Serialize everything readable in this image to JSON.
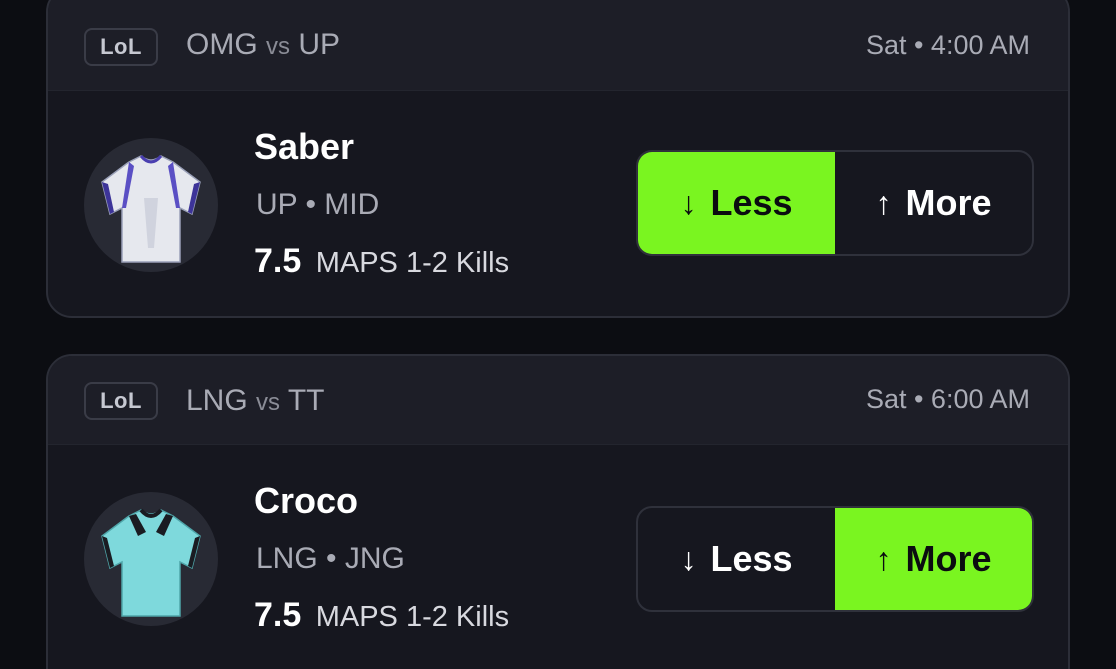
{
  "cards": [
    {
      "league": "LoL",
      "team1": "OMG",
      "vs": "vs",
      "team2": "UP",
      "time": "Sat • 4:00 AM",
      "player": "Saber",
      "team_position": "UP • MID",
      "line": "7.5",
      "stat": "MAPS 1-2 Kills",
      "jersey_colors": {
        "body": "#e6e8ee",
        "accent": "#5a4fc4"
      },
      "less_label": "Less",
      "more_label": "More",
      "selected": "less"
    },
    {
      "league": "LoL",
      "team1": "LNG",
      "vs": "vs",
      "team2": "TT",
      "time": "Sat • 6:00 AM",
      "player": "Croco",
      "team_position": "LNG • JNG",
      "line": "7.5",
      "stat": "MAPS 1-2 Kills",
      "jersey_colors": {
        "body": "#7ed9dc",
        "accent": "#1a1c22"
      },
      "less_label": "Less",
      "more_label": "More",
      "selected": "more"
    }
  ],
  "icons": {
    "less": "arrow-down-icon",
    "more": "arrow-up-icon"
  },
  "colors": {
    "selected": "#7af520",
    "background": "#0c0d12",
    "card": "#16171f"
  }
}
